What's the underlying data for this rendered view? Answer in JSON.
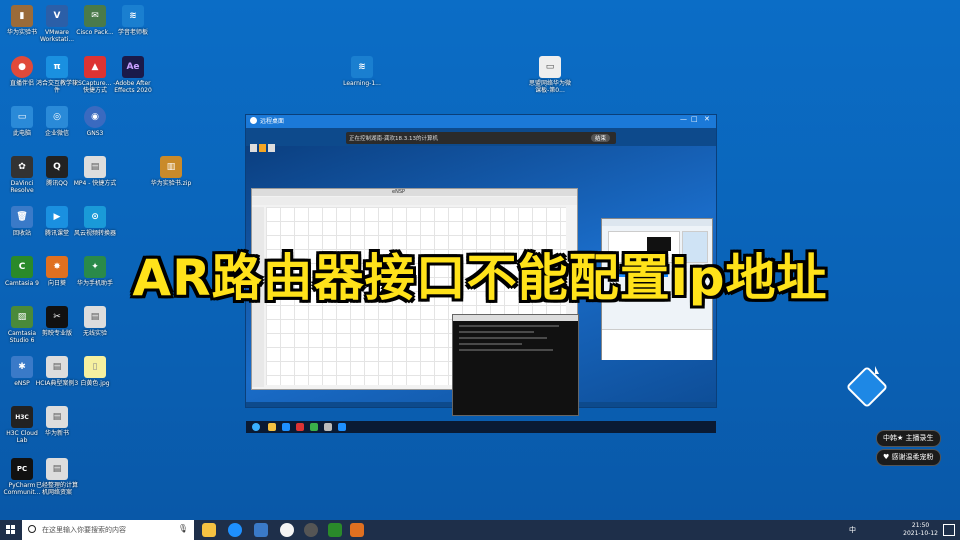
{
  "desktop_icons": [
    {
      "label": "华为实验书",
      "glyph": "▮",
      "color": "#9a6b3a"
    },
    {
      "label": "VMware Workstati...",
      "glyph": "V",
      "color": "#2b5fa8"
    },
    {
      "label": "Cisco Pack...",
      "glyph": "✉",
      "color": "#4a7a4a"
    },
    {
      "label": "学音老师板",
      "glyph": "≋",
      "color": "#1a7fd0"
    },
    {
      "label": "直播伴侣",
      "glyph": "●",
      "color": "#e04a3a"
    },
    {
      "label": "鸿合交互教学软件",
      "glyph": "π",
      "color": "#1a90e0"
    },
    {
      "label": "FSCapture... - 快捷方式",
      "glyph": "▲",
      "color": "#d33"
    },
    {
      "label": "Adobe After Effects 2020",
      "glyph": "Ae",
      "color": "#1a1a4a"
    },
    {
      "label": "此电脑",
      "glyph": "▭",
      "color": "#2a8ad8"
    },
    {
      "label": "企业微信",
      "glyph": "◎",
      "color": "#2a8ad8"
    },
    {
      "label": "GNS3",
      "glyph": "◉",
      "color": "#3a6ac0"
    },
    {
      "label": "DaVinci Resolve",
      "glyph": "✿",
      "color": "#333"
    },
    {
      "label": "腾讯QQ",
      "glyph": "Q",
      "color": "#222"
    },
    {
      "label": "MP4 - 快捷方式",
      "glyph": "▤",
      "color": "#ddd"
    },
    {
      "label": "华为实验书.zip",
      "glyph": "▥",
      "color": "#c98a2a"
    },
    {
      "label": "回收站",
      "glyph": "🗑",
      "color": "#3a7ac8"
    },
    {
      "label": "腾讯课堂",
      "glyph": "▶",
      "color": "#1a90e0"
    },
    {
      "label": "风云视频转换器",
      "glyph": "⊙",
      "color": "#1a9ad8"
    },
    {
      "label": "Camtasia 9",
      "glyph": "C",
      "color": "#2a8a2a"
    },
    {
      "label": "向日葵",
      "glyph": "✸",
      "color": "#e07020"
    },
    {
      "label": "华为手机助手",
      "glyph": "✦",
      "color": "#2a8a4a"
    },
    {
      "label": "Camtasia Studio 6",
      "glyph": "▨",
      "color": "#4a8a3a"
    },
    {
      "label": "剪映专业版",
      "glyph": "✂",
      "color": "#111"
    },
    {
      "label": "无线实验",
      "glyph": "▤",
      "color": "#ddd"
    },
    {
      "label": "eNSP",
      "glyph": "✱",
      "color": "#3a7ac8"
    },
    {
      "label": "HCIA典型案例3",
      "glyph": "▤",
      "color": "#ddd"
    },
    {
      "label": "白黄色.jpg",
      "glyph": "▯",
      "color": "#f5f0a0"
    },
    {
      "label": "H3C Cloud Lab",
      "glyph": "H3C",
      "color": "#222"
    },
    {
      "label": "华为新书",
      "glyph": "▤",
      "color": "#ddd"
    },
    {
      "label": "PyCharm Communit...",
      "glyph": "PC",
      "color": "#111"
    },
    {
      "label": "已经整理的计算机网络资案",
      "glyph": "▤",
      "color": "#ddd"
    },
    {
      "label": "Learning-1...",
      "glyph": "≋",
      "color": "#1a7fd0"
    },
    {
      "label": "思盟网络华为微课板-第0...",
      "glyph": "▭",
      "color": "#eee"
    }
  ],
  "remote_window": {
    "title": "远程桌面",
    "controls": [
      "—",
      "□",
      "✕"
    ],
    "control_bar_text": "正在控制湖南-龚欢18.3.13的计算机",
    "control_bar_button": "结束",
    "ensp_title": "eNSP"
  },
  "headline": "AR路由器接口不能配置ip地址",
  "pills": [
    {
      "text": "中韩★ 主播录生"
    },
    {
      "text": "♥ 感谢温柔宠粉"
    }
  ],
  "taskbar": {
    "search_placeholder": "在这里输入你要搜索的内容",
    "time": "21:50",
    "date": "2021-10-12",
    "ime": "中"
  },
  "colors": {
    "desktop": "#0a64b8",
    "headline": "#ffe21a",
    "taskbar": "#1e2f4a"
  }
}
